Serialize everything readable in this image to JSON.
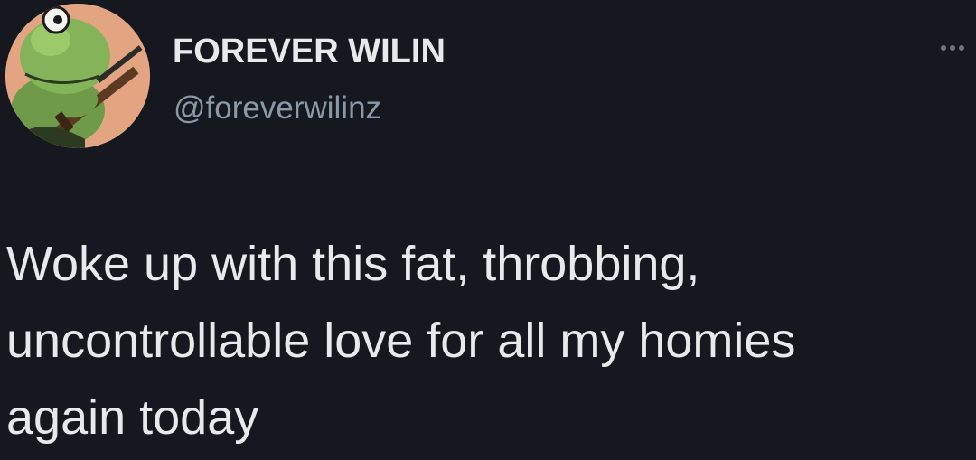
{
  "tweet": {
    "author": {
      "display_name": "FOREVER WILIN",
      "handle": "@foreverwilinz",
      "avatar_icon": "frog-with-rifle-avatar"
    },
    "more_icon": "more-options-icon",
    "text_lines": [
      "Woke up with this fat, throbbing,",
      "uncontrollable love for all my homies",
      "again today"
    ]
  },
  "colors": {
    "background": "#15181f",
    "primary_text": "#e7e9ea",
    "secondary_text": "#8b98a5",
    "avatar_background": "#e3a581"
  }
}
